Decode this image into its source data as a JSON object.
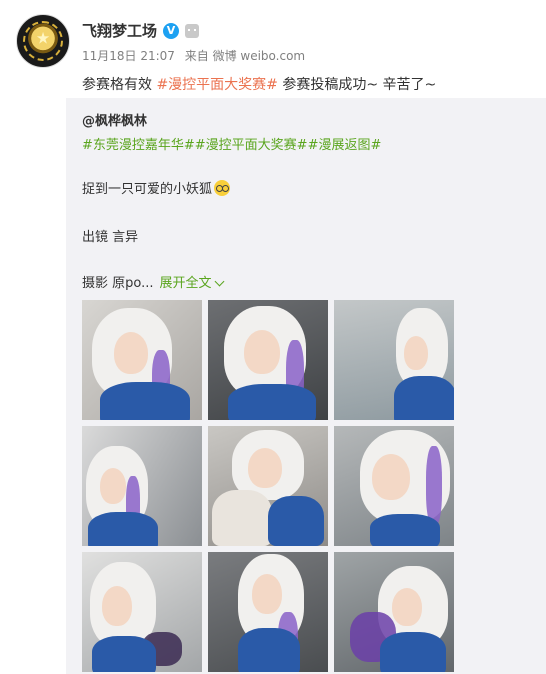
{
  "account": {
    "name": "飞翔梦工场",
    "verified_label": "V",
    "date": "11月18日 21:07",
    "source": "来自 微博 weibo.com"
  },
  "post": {
    "prefix": "参赛格有效 ",
    "topic": "#漫控平面大奖赛#",
    "suffix": " 参赛投稿成功~ 辛苦了~"
  },
  "repost": {
    "author": "@枫桦枫林",
    "tags": "#东莞漫控嘉年华##漫控平面大奖赛##漫展返图#",
    "line1": "捉到一只可爱的小妖狐",
    "line2": "出镜 言异",
    "line3": "摄影 原po...",
    "expand_label": "展开全文"
  },
  "photos": [
    {
      "label": "photo-1"
    },
    {
      "label": "photo-2"
    },
    {
      "label": "photo-3"
    },
    {
      "label": "photo-4"
    },
    {
      "label": "photo-5"
    },
    {
      "label": "photo-6"
    },
    {
      "label": "photo-7"
    },
    {
      "label": "photo-8"
    },
    {
      "label": "photo-9"
    }
  ],
  "colors": {
    "link_green": "#5aa51e",
    "topic_orange": "#eb7350",
    "meta_gray": "#808080",
    "repost_bg": "#f2f2f5"
  }
}
